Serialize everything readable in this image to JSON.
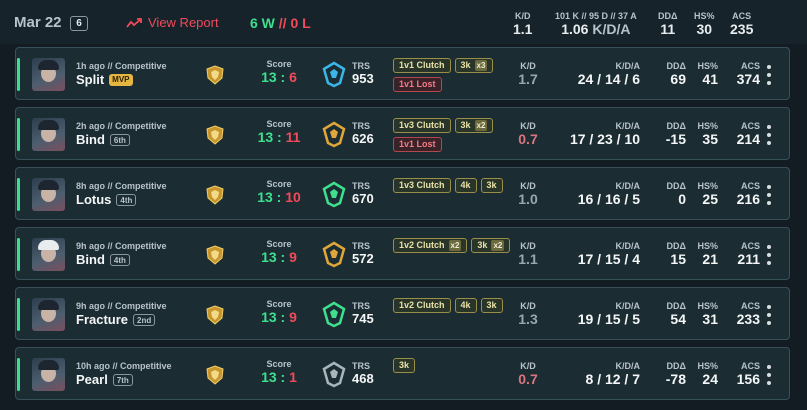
{
  "header": {
    "date": "Mar 22",
    "match_count": "6",
    "report_label": "View Report",
    "wins": "6 W",
    "sep": "//",
    "losses": "0 L",
    "kd_label": "K/D",
    "kd_value": "1.1",
    "kda_label": "101 K // 95 D // 37 A",
    "kda_value": "1.06",
    "kda_unit": "K/D/A",
    "dd_label": "DDΔ",
    "dd_value": "11",
    "hs_label": "HS%",
    "hs_value": "30",
    "acs_label": "ACS",
    "acs_value": "235"
  },
  "labels": {
    "score": "Score",
    "trs": "TRS",
    "kd": "K/D",
    "kda": "K/D/A",
    "dd": "DDΔ",
    "hs": "HS%",
    "acs": "ACS"
  },
  "matches": [
    {
      "ago": "1h ago // Competitive",
      "map": "Split",
      "badge": "MVP",
      "badge_type": "mvp",
      "score_us": "13",
      "score_them": "6",
      "trs": "953",
      "tags": [
        {
          "text": "1v1 Clutch",
          "mult": "",
          "red": false
        },
        {
          "text": "3k",
          "mult": "x3",
          "red": false
        },
        {
          "text": "1v1 Lost",
          "mult": "",
          "red": true
        }
      ],
      "kd": "1.7",
      "kd_style": "dim",
      "kda": "24 / 14 / 6",
      "dd": "69",
      "hs": "41",
      "acs": "374",
      "rank_color": "#3ab6e8",
      "avatar": "dark"
    },
    {
      "ago": "2h ago // Competitive",
      "map": "Bind",
      "badge": "6th",
      "badge_type": "place",
      "score_us": "13",
      "score_them": "11",
      "trs": "626",
      "tags": [
        {
          "text": "1v3 Clutch",
          "mult": "",
          "red": false
        },
        {
          "text": "3k",
          "mult": "x2",
          "red": false
        },
        {
          "text": "1v1 Lost",
          "mult": "",
          "red": true
        }
      ],
      "kd": "0.7",
      "kd_style": "bad",
      "kda": "17 / 23 / 10",
      "dd": "-15",
      "hs": "35",
      "acs": "214",
      "rank_color": "#e0a63a",
      "avatar": "dark"
    },
    {
      "ago": "8h ago // Competitive",
      "map": "Lotus",
      "badge": "4th",
      "badge_type": "place",
      "score_us": "13",
      "score_them": "10",
      "trs": "670",
      "tags": [
        {
          "text": "1v3 Clutch",
          "mult": "",
          "red": false
        },
        {
          "text": "4k",
          "mult": "",
          "red": false
        },
        {
          "text": "3k",
          "mult": "",
          "red": false
        }
      ],
      "kd": "1.0",
      "kd_style": "dim",
      "kda": "16 / 16 / 5",
      "dd": "0",
      "hs": "25",
      "acs": "216",
      "rank_color": "#3ee08e",
      "avatar": "dark"
    },
    {
      "ago": "9h ago // Competitive",
      "map": "Bind",
      "badge": "4th",
      "badge_type": "place",
      "score_us": "13",
      "score_them": "9",
      "trs": "572",
      "tags": [
        {
          "text": "1v2 Clutch",
          "mult": "x2",
          "red": false
        },
        {
          "text": "3k",
          "mult": "x2",
          "red": false
        }
      ],
      "kd": "1.1",
      "kd_style": "dim",
      "kda": "17 / 15 / 4",
      "dd": "15",
      "hs": "21",
      "acs": "211",
      "rank_color": "#e0a63a",
      "avatar": "white"
    },
    {
      "ago": "9h ago // Competitive",
      "map": "Fracture",
      "badge": "2nd",
      "badge_type": "place",
      "score_us": "13",
      "score_them": "9",
      "trs": "745",
      "tags": [
        {
          "text": "1v2 Clutch",
          "mult": "",
          "red": false
        },
        {
          "text": "4k",
          "mult": "",
          "red": false
        },
        {
          "text": "3k",
          "mult": "",
          "red": false
        }
      ],
      "kd": "1.3",
      "kd_style": "dim",
      "kda": "19 / 15 / 5",
      "dd": "54",
      "hs": "31",
      "acs": "233",
      "rank_color": "#3ee08e",
      "avatar": "dark"
    },
    {
      "ago": "10h ago // Competitive",
      "map": "Pearl",
      "badge": "7th",
      "badge_type": "place",
      "score_us": "13",
      "score_them": "1",
      "trs": "468",
      "tags": [
        {
          "text": "3k",
          "mult": "",
          "red": false
        }
      ],
      "kd": "0.7",
      "kd_style": "bad",
      "kda": "8 / 12 / 7",
      "dd": "-78",
      "hs": "24",
      "acs": "156",
      "rank_color": "#aab4bb",
      "avatar": "dark"
    }
  ]
}
